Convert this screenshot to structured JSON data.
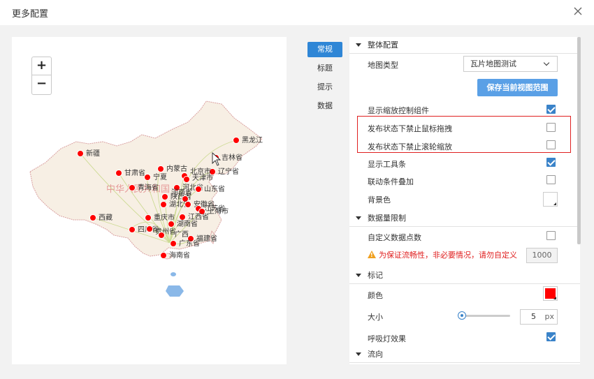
{
  "dialog": {
    "title": "更多配置"
  },
  "map": {
    "zoom_in": "+",
    "zoom_out": "−",
    "watermark": "中华人民共和国",
    "cities": [
      {
        "name": "黑龙江"
      },
      {
        "name": "吉林省"
      },
      {
        "name": "辽宁省"
      },
      {
        "name": "内蒙古"
      },
      {
        "name": "北京市"
      },
      {
        "name": "天津市"
      },
      {
        "name": "新疆"
      },
      {
        "name": "甘肃省"
      },
      {
        "name": "宁夏"
      },
      {
        "name": "青海省"
      },
      {
        "name": "河北省"
      },
      {
        "name": "山东省"
      },
      {
        "name": "陕西省"
      },
      {
        "name": "河南省"
      },
      {
        "name": "湖北省"
      },
      {
        "name": "安徽省"
      },
      {
        "name": "江苏省"
      },
      {
        "name": "上海市"
      },
      {
        "name": "西藏"
      },
      {
        "name": "重庆市"
      },
      {
        "name": "江西省"
      },
      {
        "name": "湖南省"
      },
      {
        "name": "四川省"
      },
      {
        "name": "贵州省"
      },
      {
        "name": "广西"
      },
      {
        "name": "福建省"
      },
      {
        "name": "广东省"
      },
      {
        "name": "海南省"
      }
    ]
  },
  "tabs": [
    "常规",
    "标题",
    "提示",
    "数据"
  ],
  "settings": {
    "overall": {
      "header": "整体配置",
      "map_type_label": "地图类型",
      "map_type_value": "瓦片地图测试",
      "save_view_button": "保存当前视图范围",
      "show_zoom_label": "显示缩放控制组件",
      "disable_drag_label": "发布状态下禁止鼠标拖拽",
      "disable_wheel_label": "发布状态下禁止滚轮缩放",
      "show_toolbar_label": "显示工具条",
      "linkage_label": "联动条件叠加",
      "bg_color_label": "背景色"
    },
    "data_limit": {
      "header": "数据量限制",
      "custom_points_label": "自定义数据点数",
      "warning": "为保证流畅性，非必要情况，请勿自定义",
      "points_value": "1000"
    },
    "marker": {
      "header": "标记",
      "color_label": "颜色",
      "color_value": "#ff0000",
      "size_label": "大小",
      "size_value": "5",
      "size_unit": "px",
      "breath_label": "呼吸灯效果"
    },
    "flow": {
      "header": "流向"
    }
  },
  "checkboxes": {
    "show_zoom": true,
    "disable_drag": false,
    "disable_wheel": false,
    "show_toolbar": true,
    "linkage": false,
    "custom_points": false,
    "breath": true
  },
  "colors": {
    "accent": "#2f86d6",
    "marker": "#ff0000",
    "flow_line": "#c8d88a",
    "highlight_box": "#e02020",
    "land": "#f7efe4",
    "border": "#d9a0a0",
    "sea_island": "#8ab8e8"
  }
}
